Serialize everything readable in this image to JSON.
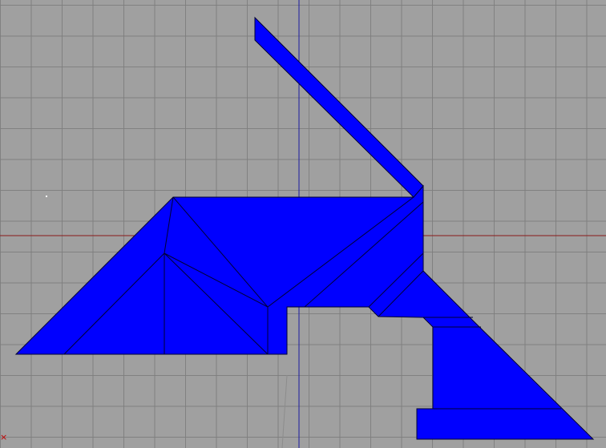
{
  "viewport": {
    "background_color": "#a0a0a0",
    "grid_color": "#7d7d7d",
    "x_axis_color": "#8a1a1a",
    "y_axis_color": "#1a1aa0"
  },
  "shape": {
    "fill_color": "#0000ff",
    "edge_color": "#000033"
  },
  "corner_axis_glyph": "×"
}
